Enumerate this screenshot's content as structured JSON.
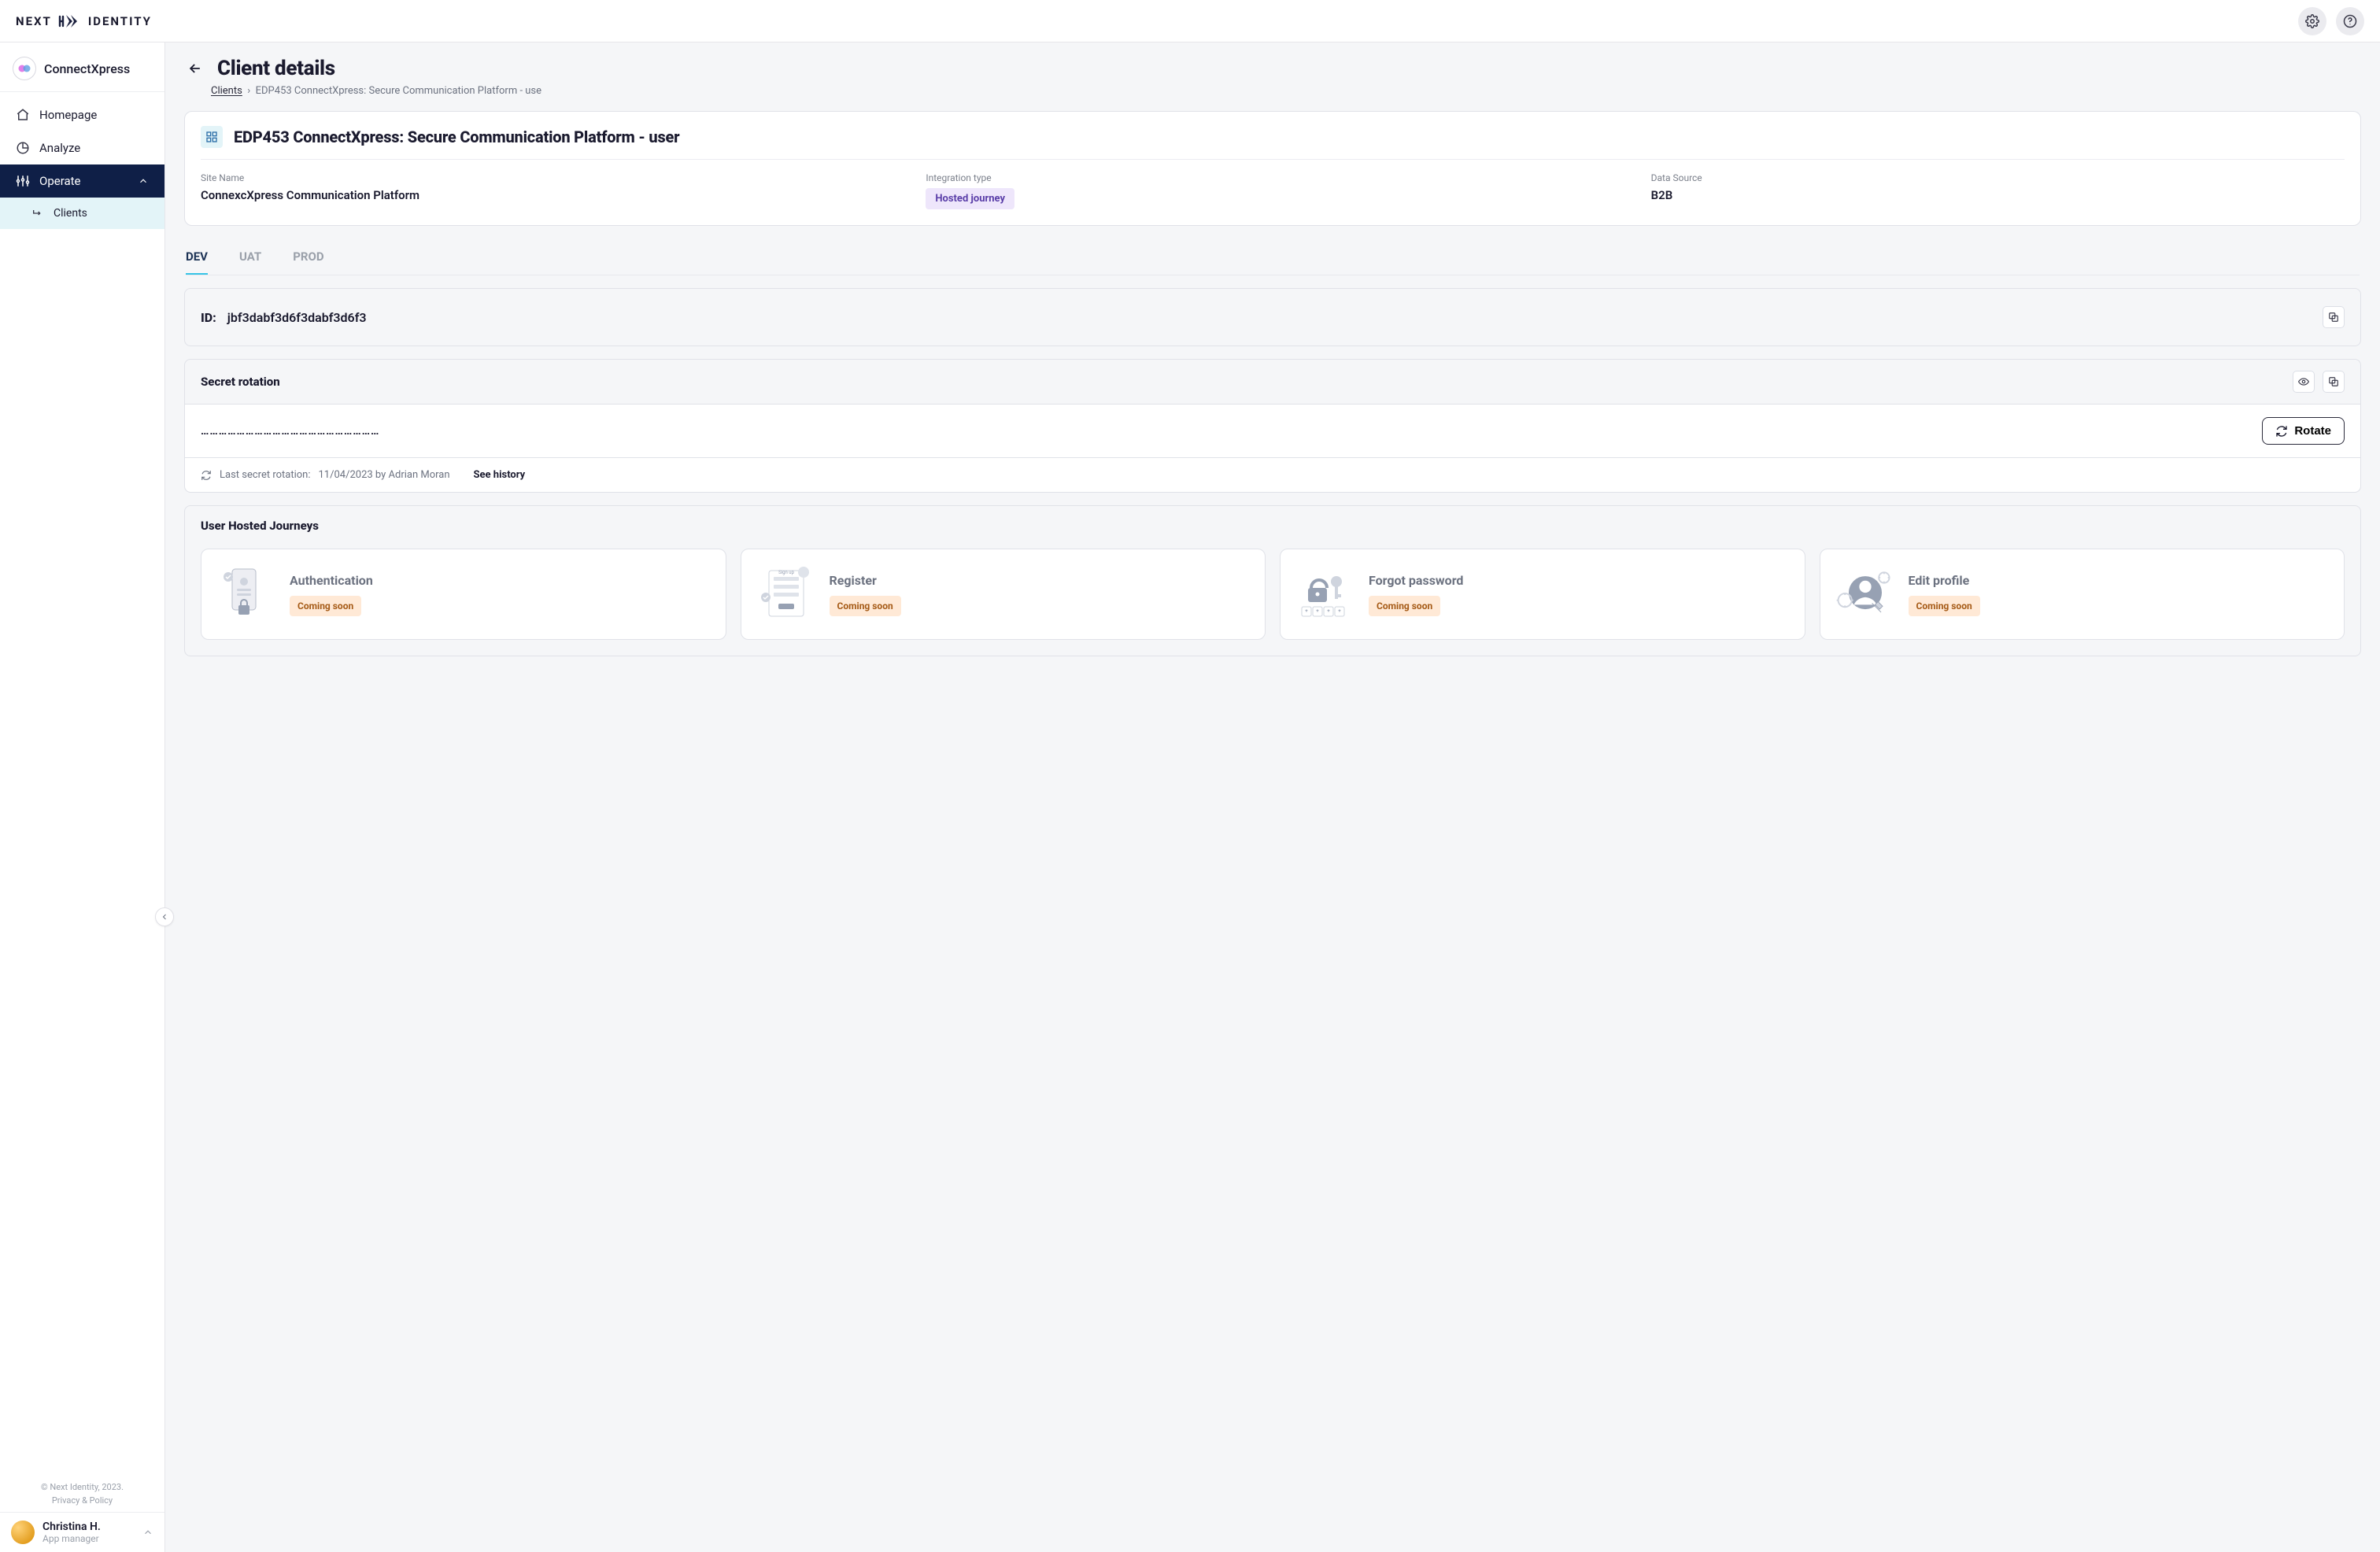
{
  "brand": {
    "prefix": "NEXT",
    "suffix": "IDENTITY"
  },
  "topbar": {
    "settings": "Settings",
    "help": "Help"
  },
  "org": {
    "name": "ConnectXpress"
  },
  "sidebar": {
    "items": [
      {
        "label": "Homepage"
      },
      {
        "label": "Analyze"
      },
      {
        "label": "Operate"
      },
      {
        "label": "Clients"
      }
    ]
  },
  "footer": {
    "copyright": "© Next Identity, 2023.",
    "privacy": "Privacy & Policy"
  },
  "user": {
    "name": "Christina H.",
    "role": "App manager"
  },
  "page": {
    "title": "Client details",
    "crumb_root": "Clients",
    "crumb_sep": "›",
    "crumb_current": "EDP453 ConnectXpress: Secure Communication Platform - use"
  },
  "client": {
    "title": "EDP453 ConnectXpress: Secure Communication Platform - user",
    "specs": {
      "site_label": "Site Name",
      "site_value": "ConnexcXpress Communication Platform",
      "integration_label": "Integration type",
      "integration_value": "Hosted journey",
      "data_label": "Data Source",
      "data_value": "B2B"
    }
  },
  "tabs": [
    {
      "label": "DEV"
    },
    {
      "label": "UAT"
    },
    {
      "label": "PROD"
    }
  ],
  "id_panel": {
    "label": "ID:",
    "value": "jbf3dabf3d6f3dabf3d6f3"
  },
  "secret": {
    "title": "Secret rotation",
    "masked": "……………………………………………………",
    "rotate_label": "Rotate",
    "last_label": "Last secret rotation:",
    "last_value": "11/04/2023 by Adrian Moran",
    "history": "See history"
  },
  "journeys": {
    "title": "User Hosted Journeys",
    "items": [
      {
        "title": "Authentication",
        "status": "Coming soon"
      },
      {
        "title": "Register",
        "status": "Coming soon"
      },
      {
        "title": "Forgot password",
        "status": "Coming soon"
      },
      {
        "title": "Edit profile",
        "status": "Coming soon"
      }
    ]
  }
}
